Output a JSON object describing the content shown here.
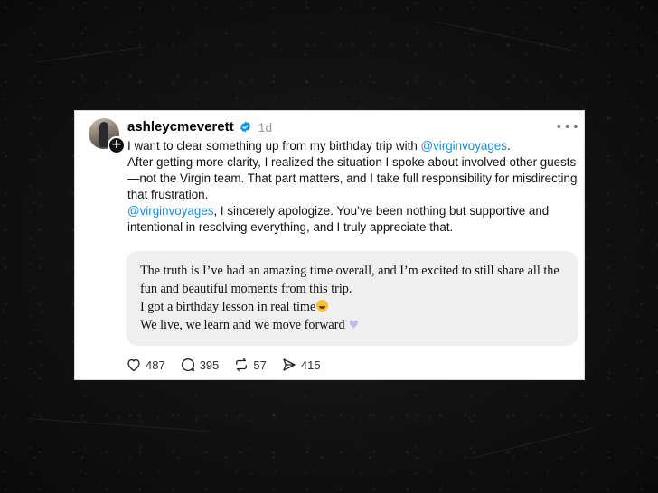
{
  "post": {
    "username": "ashleycmeverett",
    "time": "1d",
    "verified": true,
    "more_icon": "more-horizontal-icon",
    "body": {
      "p1_pre": "I want to clear something up from my birthday trip with ",
      "p1_mention": "@virginvoyages",
      "p1_post": ".",
      "p2": "After getting more clarity, I realized the situation I spoke about involved other guests—not the Virgin team. That part matters, and I take full responsibility for misdirecting that frustration.",
      "p3_mention": "@virginvoyages",
      "p3_post": ", I sincerely apologize. You’ve been nothing but supportive and intentional in resolving everything, and I truly appreciate that."
    },
    "quote": {
      "line1": "The truth is I’ve had an amazing time overall, and I’m excited to still share all the fun and beautiful moments from this trip.",
      "line2": "I got a birthday lesson in real time",
      "line3": "We live, we learn and we move forward",
      "emoji_1": "smiling-face-with-sweat-emoji",
      "emoji_2": "purple-heart-emoji"
    },
    "actions": {
      "likes": "487",
      "replies": "395",
      "reposts": "57",
      "shares": "415"
    },
    "colors": {
      "mention": "#1a8cd8",
      "verified": "#0095f6",
      "card_bg": "#ffffff",
      "quote_bg": "#efefef"
    }
  }
}
